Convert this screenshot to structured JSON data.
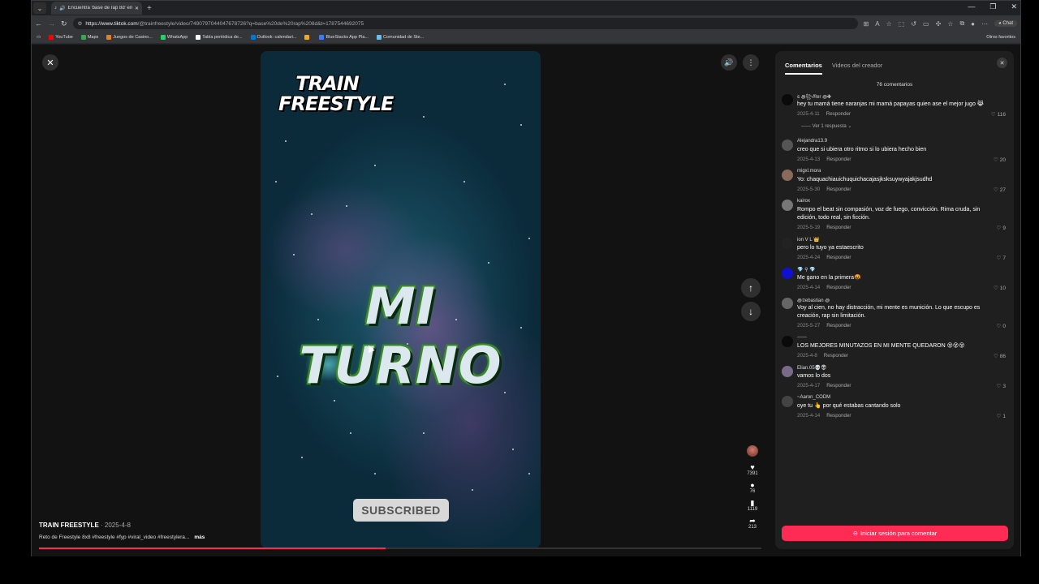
{
  "browser": {
    "tab_title": "Encuentra 'base de rap 8d' en",
    "url_host": "https://www.tiktok.com",
    "url_path": "/@trainfreestyle/video/7490797044047678726?q=base%20de%20rap%208d&t=1787544692075",
    "chat_label": "Chat",
    "bookmarks": [
      {
        "label": "YouTube",
        "color": "#ff0000"
      },
      {
        "label": "Maps",
        "color": "#34a853"
      },
      {
        "label": "Juegos de Casino...",
        "color": "#e67e22"
      },
      {
        "label": "WhatsApp",
        "color": "#25d366"
      },
      {
        "label": "Tabla periódica de...",
        "color": "#ffffff"
      },
      {
        "label": "Outlook: calendari...",
        "color": "#0078d4"
      },
      {
        "label": "",
        "color": "#f5a623"
      },
      {
        "label": "BlueStacks App Pla...",
        "color": "#3d7bfd"
      },
      {
        "label": "Comunidad de Ste...",
        "color": "#66c0f4"
      }
    ],
    "bookmarks_right": "Otros favoritos"
  },
  "video": {
    "logo_line1": "TRAIN",
    "logo_line2": "FREESTYLE",
    "main_text": "MI TURNO",
    "subscribed_label": "SUBSCRIBED",
    "author": "TRAIN FREESTYLE",
    "date": "· 2025-4-8",
    "description": "Reto de Freestyle 8x8 #freestyle #fyp #viral_video #freestylera...",
    "more_label": "más",
    "progress": 0.48,
    "likes": "7391",
    "comments": "76",
    "saves": "1119",
    "shares": "213"
  },
  "panel": {
    "tab_comments": "Comentarios",
    "tab_creator": "Videos del creador",
    "count_label": "76 comentarios",
    "replies_toggle": "Ver 1 respuesta",
    "login_label": "Iniciar sesión para comentar",
    "comments": [
      {
        "user": "ꜱ ꩜꧂𝔑er ꩜✤",
        "text": "hey tu mamá tiene naranjas mi mamá papayas quien ase el mejor jugo 😹",
        "date": "2025-4-11",
        "reply": "Responder",
        "likes": "116",
        "avatar": "#0a0a0a"
      },
      {
        "user": "Alejandra13.9",
        "text": "creo que si ubiera otro ritmo si lo ubiera hecho bien",
        "date": "2025-4-13",
        "reply": "Responder",
        "likes": "20",
        "avatar": "#555555"
      },
      {
        "user": "migxl.mora",
        "text": "Yo: chaquachiauichuquichacajasjksksuywyajakjsudhd",
        "date": "2025-5-30",
        "reply": "Responder",
        "likes": "27",
        "avatar": "#8a6a5a"
      },
      {
        "user": "kairox",
        "text": "Rompo el beat sin compasión, voz de fuego, convicción. Rima cruda, sin edición, todo real, sin ficción.",
        "date": "2025-5-19",
        "reply": "Responder",
        "likes": "9",
        "avatar": "#777777"
      },
      {
        "user": "ion V L 👑",
        "text": "pero lo tuyo ya estaescrito",
        "date": "2025-4-24",
        "reply": "Responder",
        "likes": "7",
        "avatar": "#222222"
      },
      {
        "user": "💎 ⚲ 💎",
        "text": "Me gano en la primera🤬",
        "date": "2025-4-14",
        "reply": "Responder",
        "likes": "10",
        "avatar": "#1010d0"
      },
      {
        "user": "꩜𝔖ebastian ꩜",
        "text": "Voy al cien, no hay distracción, mi mente es munición. Lo que escupo es creación, rap sin limitación.",
        "date": "2025-5-27",
        "reply": "Responder",
        "likes": "0",
        "avatar": "#666666"
      },
      {
        "user": "------",
        "text": "LOS MEJORES MINUTAZOS EN MI MENTE QUEDARON 😵😵😵",
        "date": "2025-4-8",
        "reply": "Responder",
        "likes": "86",
        "avatar": "#0a0a0a"
      },
      {
        "user": "Elian.05💀👽",
        "text": "vamos lo dos",
        "date": "2025-4-17",
        "reply": "Responder",
        "likes": "3",
        "avatar": "#7a6a8a"
      },
      {
        "user": "~Aaron_CODM",
        "text": "oye tu 👆 por qué estabas cantando solo",
        "date": "2025-4-14",
        "reply": "Responder",
        "likes": "1",
        "avatar": "#444444"
      }
    ]
  },
  "colors": {
    "accent": "#fe2c55",
    "panel": "#1f1f1f",
    "page": "#121212"
  }
}
